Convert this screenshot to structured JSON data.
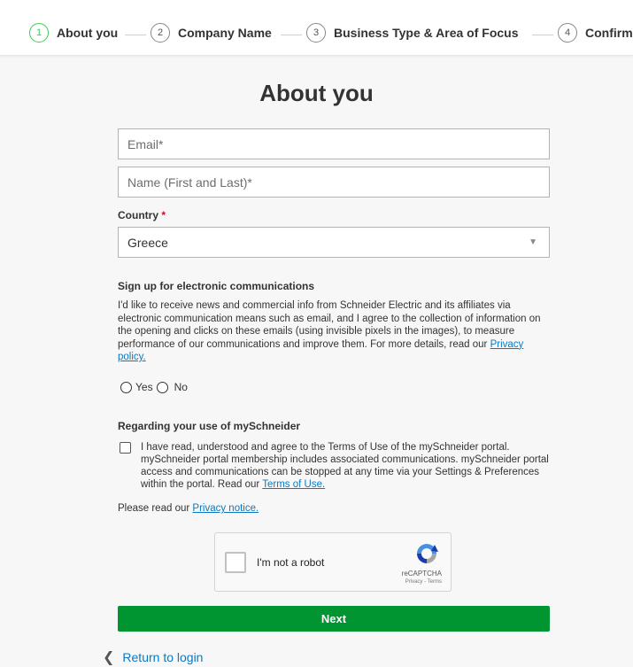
{
  "stepper": {
    "steps": [
      {
        "number": "1",
        "label": "About you",
        "active": true
      },
      {
        "number": "2",
        "label": "Company Name",
        "active": false
      },
      {
        "number": "3",
        "label": "Business Type & Area of Focus",
        "active": false
      },
      {
        "number": "4",
        "label": "Confirm",
        "active": false
      }
    ]
  },
  "form": {
    "title": "About you",
    "email_placeholder": "Email*",
    "name_placeholder": "Name (First and Last)*",
    "country_label": "Country",
    "required_mark": "*",
    "country_value": "Greece"
  },
  "communications": {
    "heading": "Sign up for electronic communications",
    "text": "I'd like to receive news and commercial info from Schneider Electric and its affiliates via electronic communication means such as email, and I agree to the collection of information on the opening and clicks on these emails (using invisible pixels in the images), to measure performance of our communications and improve them. For more details, read our",
    "privacy_link": "Privacy policy.",
    "yes_label": "Yes",
    "no_label": "No"
  },
  "terms": {
    "heading": "Regarding your use of mySchneider",
    "text": "I have read, understood and agree to the Terms of Use of the mySchneider portal. mySchneider portal membership includes associated communications. mySchneider portal access and communications can be stopped at any time via your Settings & Preferences within the portal. Read our",
    "terms_link": "Terms of Use.",
    "notice_prefix": "Please read our",
    "notice_link": "Privacy notice."
  },
  "captcha": {
    "label": "I'm not a robot",
    "brand": "reCAPTCHA",
    "sub": "Privacy - Terms"
  },
  "actions": {
    "next_label": "Next",
    "back_label": "Return to login"
  },
  "colors": {
    "active_step": "#3dcd58",
    "next_button": "#009530",
    "link": "#0b79c1"
  }
}
